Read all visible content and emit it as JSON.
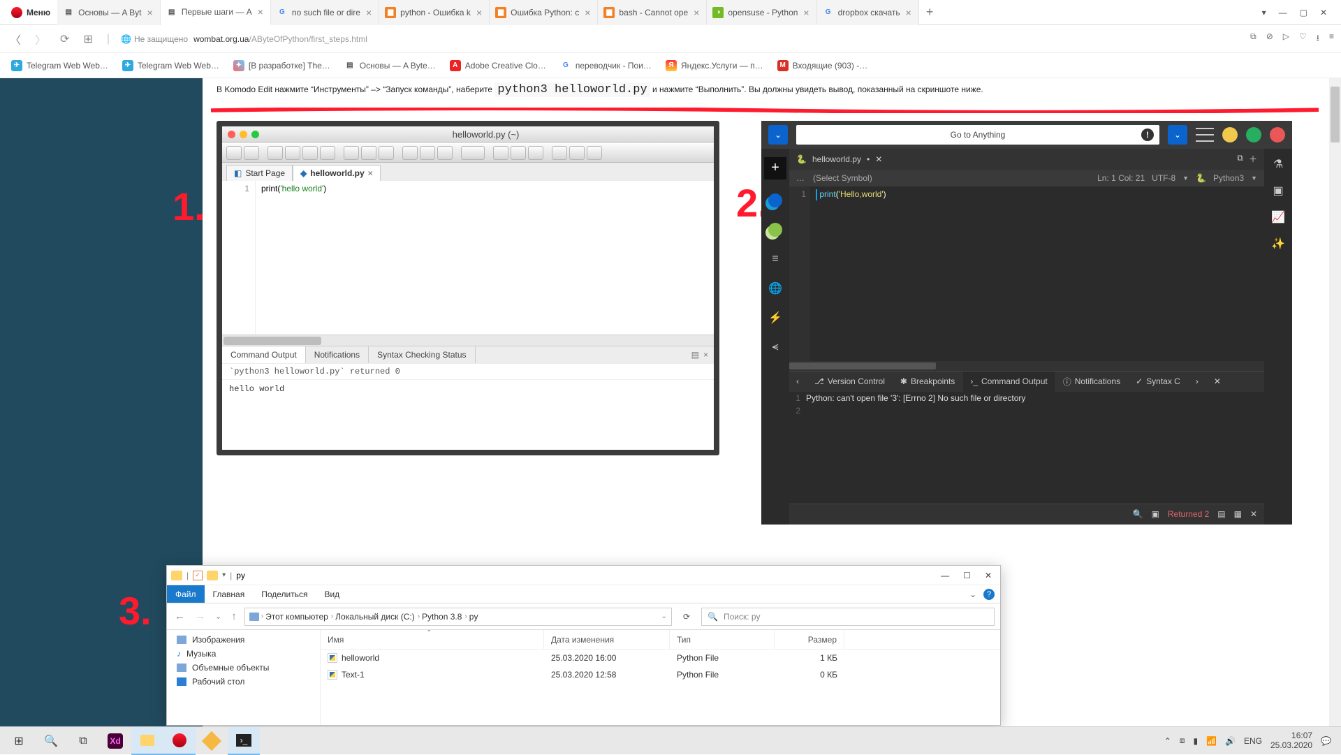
{
  "opera": {
    "menu": "Меню",
    "tabs": [
      {
        "title": "Основы — A Byt",
        "icon": "doc"
      },
      {
        "title": "Первые шаги — A",
        "icon": "doc",
        "active": true
      },
      {
        "title": "no such file or dire",
        "icon": "g"
      },
      {
        "title": "python - Ошибка k",
        "icon": "so"
      },
      {
        "title": "Ошибка Python: c",
        "icon": "so"
      },
      {
        "title": "bash - Cannot ope",
        "icon": "so"
      },
      {
        "title": "opensuse - Python",
        "icon": "suse"
      },
      {
        "title": "dropbox скачать",
        "icon": "g"
      }
    ],
    "insecure": "Не защищено",
    "url_host": "wombat.org.ua",
    "url_path": "/AByteOfPython/first_steps.html",
    "bookmarks": [
      {
        "label": "Telegram Web Web…",
        "color": "#2fa7df"
      },
      {
        "label": "Telegram Web Web…",
        "color": "#2fa7df"
      },
      {
        "label": "[В разработке] The…",
        "color": "#ff7a00"
      },
      {
        "label": "Основы — A Byte…",
        "color": "#555"
      },
      {
        "label": "Adobe Creative Clo…",
        "color": "#ed2224"
      },
      {
        "label": "переводчик - Пои…",
        "color": "#4285f4"
      },
      {
        "label": "Яндекс.Услуги — п…",
        "color": "#ff3333"
      },
      {
        "label": "Входящие (903) -…",
        "color": "#d93025"
      }
    ]
  },
  "page": {
    "instruction_pre": "В Komodo Edit нажмите “Инструменты” –> “Запуск команды”, наберите ",
    "instruction_code": "python3 helloworld.py",
    "instruction_post": " и нажмите “Выполнить”. Вы должны увидеть вывод, показанный на скриншоте ниже."
  },
  "annotations": {
    "one": "1.",
    "two": "2.",
    "three": "3."
  },
  "komodo_light": {
    "title": "helloworld.py (~)",
    "tabs": {
      "start": "Start Page",
      "file": "helloworld.py"
    },
    "code_line_no": "1",
    "code": {
      "fn": "print",
      "open": "(",
      "str": "'hello world'",
      "close": ")"
    },
    "bottom_tabs": {
      "cmd": "Command Output",
      "notif": "Notifications",
      "syntax": "Syntax Checking Status"
    },
    "out_header": "`python3 helloworld.py` returned 0",
    "out_body": "hello world"
  },
  "komodo_dark": {
    "goto": "Go to Anything",
    "file": "helloworld.py",
    "file_dirty": "•",
    "select_symbol": "(Select Symbol)",
    "status": {
      "pos": "Ln: 1 Col: 21",
      "enc": "UTF-8",
      "lang": "Python3"
    },
    "code_line_no": "1",
    "code": {
      "fn": "print",
      "open": "(",
      "str": "'Hello,world'",
      "close": ")"
    },
    "panels": {
      "vc": "Version Control",
      "bp": "Breakpoints",
      "cmd": "Command Output",
      "notif": "Notifications",
      "syntax": "Syntax C"
    },
    "out_lines": [
      {
        "n": "1",
        "t": "Python: can't open file '3': [Errno 2] No such file or directory"
      },
      {
        "n": "2",
        "t": ""
      }
    ],
    "footer_returned": "Returned 2"
  },
  "explorer": {
    "title": "py",
    "ribbon": {
      "file": "Файл",
      "home": "Главная",
      "share": "Поделиться",
      "view": "Вид"
    },
    "path": [
      "Этот компьютер",
      "Локальный диск (C:)",
      "Python 3.8",
      "py"
    ],
    "search_placeholder": "Поиск: py",
    "side": [
      "Изображения",
      "Музыка",
      "Объемные объекты",
      "Рабочий стол"
    ],
    "cols": {
      "name": "Имя",
      "date": "Дата изменения",
      "type": "Тип",
      "size": "Размер"
    },
    "rows": [
      {
        "name": "helloworld",
        "date": "25.03.2020 16:00",
        "type": "Python File",
        "size": "1 КБ"
      },
      {
        "name": "Text-1",
        "date": "25.03.2020 12:58",
        "type": "Python File",
        "size": "0 КБ"
      }
    ]
  },
  "taskbar": {
    "lang": "ENG",
    "time": "16:07",
    "date": "25.03.2020"
  }
}
